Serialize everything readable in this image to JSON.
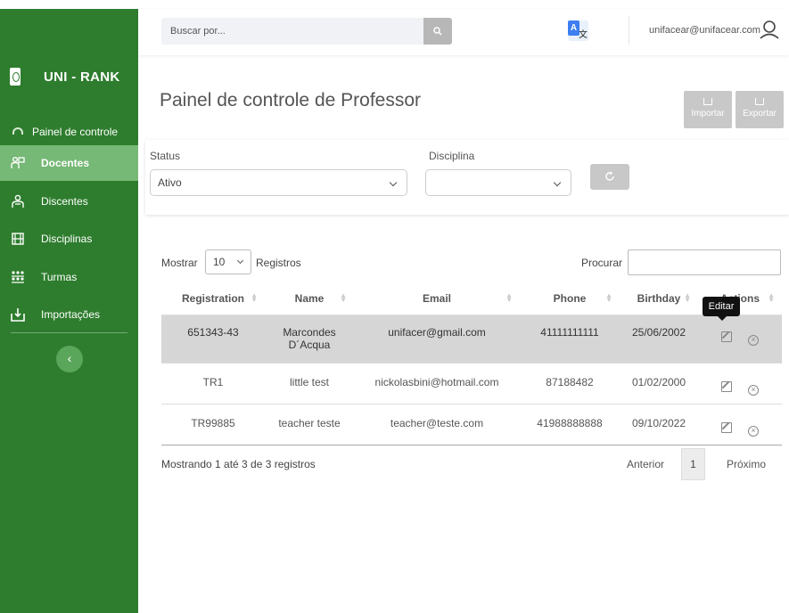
{
  "brand": {
    "name": "UNI - RANK"
  },
  "sidebar": {
    "items": [
      {
        "label": "Painel de controle",
        "icon": "dashboard-icon"
      },
      {
        "label": "Docentes",
        "icon": "teacher-icon",
        "active": true
      },
      {
        "label": "Discentes",
        "icon": "student-icon"
      },
      {
        "label": "Disciplinas",
        "icon": "subjects-icon"
      },
      {
        "label": "Turmas",
        "icon": "classes-icon"
      },
      {
        "label": "Importações",
        "icon": "import-icon"
      }
    ],
    "collapse_symbol": "‹"
  },
  "topbar": {
    "search_placeholder": "Buscar por...",
    "user_email": "unifacear@unifacear.com",
    "translate_letter": "A",
    "translate_glyph": "文"
  },
  "page": {
    "title": "Painel de controle de Professor",
    "import_label": "Importar",
    "export_label": "Exportar"
  },
  "filters": {
    "status_label": "Status",
    "status_value": "Ativo",
    "discipline_label": "Disciplina",
    "discipline_value": ""
  },
  "table_controls": {
    "show_label": "Mostrar",
    "page_length": "10",
    "records_label": "Registros",
    "search_label": "Procurar"
  },
  "table": {
    "headers": [
      "Registration",
      "Name",
      "Email",
      "Phone",
      "Birthday",
      "Actions"
    ],
    "rows": [
      {
        "registration": "651343-43",
        "name": "Marcondes D´Acqua",
        "email": "unifacer@gmail.com",
        "phone": "41111111111",
        "birthday": "25/06/2002"
      },
      {
        "registration": "TR1",
        "name": "little test",
        "email": "nickolasbini@hotmail.com",
        "phone": "87188482",
        "birthday": "01/02/2000"
      },
      {
        "registration": "TR99885",
        "name": "teacher teste",
        "email": "teacher@teste.com",
        "phone": "41988888888",
        "birthday": "09/10/2022"
      }
    ],
    "tooltip": "Editar"
  },
  "pagination": {
    "info": "Mostrando 1 até 3 de 3 registros",
    "prev": "Anterior",
    "current": "1",
    "next": "Próximo"
  },
  "colors": {
    "sidebar_bg": "#2e7d2e",
    "sidebar_active": "#76b876",
    "highlight_row": "#d6d6d6"
  }
}
